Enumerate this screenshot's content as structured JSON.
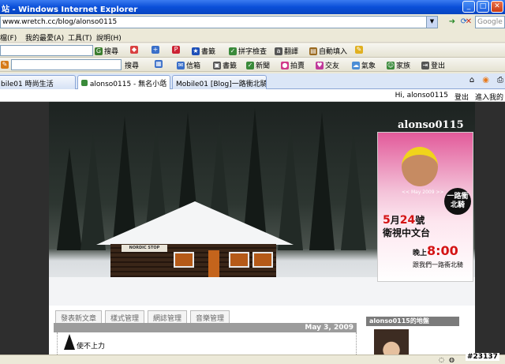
{
  "window": {
    "title": "站 - Windows Internet Explorer",
    "address": "www.wretch.cc/blog/alonso0115",
    "search_placeholder": "Google"
  },
  "menu": [
    "檔(F)",
    "我的最愛(A)",
    "工具(T)",
    "說明(H)"
  ],
  "toolbar1": {
    "search_label": "搜尋",
    "items": [
      "書籤",
      "拼字檢查",
      "翻譯",
      "自動填入"
    ]
  },
  "toolbar2": {
    "search_label": "搜尋",
    "items": [
      "信箱",
      "書籤",
      "新聞",
      "拍賣",
      "交友",
      "氣象",
      "家族",
      "登出"
    ]
  },
  "tabs": [
    {
      "label": "bile01 時尚生活"
    },
    {
      "label": "alonso0115 - 無名小站",
      "active": true
    },
    {
      "label": "Mobile01 [Blog]一路衝北騎..."
    }
  ],
  "strip": {
    "greeting": "Hi, alonso0115",
    "logout": "登出",
    "enter": "進入我的"
  },
  "blog": {
    "title": "alonso0115",
    "sign": "NORDIC STOP",
    "promo": {
      "badge": "一路衝北騎",
      "may": "<< May 2009 >>",
      "line1_num1": "5",
      "line1_mid": "月",
      "line1_num2": "24",
      "line1_end": "號",
      "line2": "衛視中文台",
      "line3_pre": "晚上",
      "line3_time": "8:00",
      "line4": "跟我們一路衝北騎"
    },
    "post_nav": [
      "發表新文章",
      "樣式管理",
      "網誌管理",
      "音樂管理"
    ],
    "date": "May 3, 2009",
    "post_title": "使不上力",
    "sidebar_heading": "alonso0115的地盤"
  },
  "watermark": "#23137"
}
